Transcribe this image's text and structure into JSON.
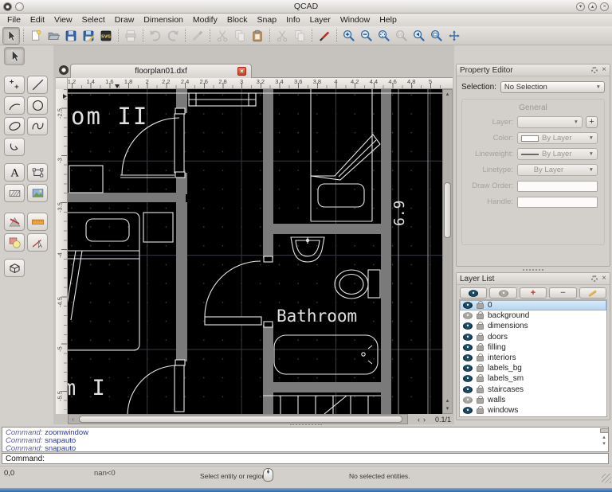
{
  "window": {
    "title": "QCAD"
  },
  "menubar": {
    "items": [
      "File",
      "Edit",
      "View",
      "Select",
      "Draw",
      "Dimension",
      "Modify",
      "Block",
      "Snap",
      "Info",
      "Layer",
      "Window",
      "Help"
    ]
  },
  "toolbar": {
    "groups": [
      [
        {
          "name": "toolbar-selection",
          "icon": "pointer",
          "enabled": true,
          "pressed": true
        }
      ],
      [
        {
          "name": "new-file",
          "icon": "new",
          "enabled": true
        },
        {
          "name": "open-file",
          "icon": "open",
          "enabled": true
        },
        {
          "name": "save",
          "icon": "save",
          "enabled": true
        },
        {
          "name": "save-as",
          "icon": "saveas",
          "enabled": true
        },
        {
          "name": "export",
          "icon": "export",
          "enabled": true
        }
      ],
      [
        {
          "name": "print",
          "icon": "print",
          "enabled": false
        }
      ],
      [
        {
          "name": "undo",
          "icon": "undo",
          "enabled": false
        },
        {
          "name": "redo",
          "icon": "redo",
          "enabled": false
        }
      ],
      [
        {
          "name": "eraser",
          "icon": "eraser",
          "enabled": false
        }
      ],
      [
        {
          "name": "cut",
          "icon": "cut",
          "enabled": false
        },
        {
          "name": "copy",
          "icon": "copy",
          "enabled": false
        },
        {
          "name": "paste",
          "icon": "paste",
          "enabled": true
        }
      ],
      [
        {
          "name": "cut-with-reference",
          "icon": "cut",
          "enabled": false
        },
        {
          "name": "paste-with-reference",
          "icon": "copy",
          "enabled": false
        }
      ],
      [
        {
          "name": "drawing-preferences",
          "icon": "penred",
          "enabled": true
        }
      ],
      [
        {
          "name": "zoom-in",
          "icon": "magplus",
          "enabled": true
        },
        {
          "name": "zoom-out",
          "icon": "magminus",
          "enabled": true
        },
        {
          "name": "auto-zoom",
          "icon": "magauto",
          "enabled": true
        },
        {
          "name": "zoom-one-to-one",
          "icon": "mag11",
          "enabled": false
        },
        {
          "name": "previous-view",
          "icon": "magprev",
          "enabled": true
        },
        {
          "name": "zoom-window",
          "icon": "magwin",
          "enabled": true
        },
        {
          "name": "pan",
          "icon": "pan",
          "enabled": true
        }
      ]
    ]
  },
  "left_toolbar": {
    "groups": [
      [
        {
          "name": "selection-pointer",
          "icon": "pointer",
          "pressed": true
        }
      ],
      [
        {
          "name": "point-tools",
          "icon": "point"
        },
        {
          "name": "line-tools",
          "icon": "line"
        },
        {
          "name": "arc-tools",
          "icon": "arc"
        },
        {
          "name": "circle-tools",
          "icon": "circle"
        },
        {
          "name": "ellipse-tools",
          "icon": "ellipse"
        },
        {
          "name": "spline-tools",
          "icon": "spline"
        },
        {
          "name": "polyline-tools",
          "icon": "polyline"
        }
      ],
      [
        {
          "name": "text-tool",
          "icon": "text"
        },
        {
          "name": "shape-tools",
          "icon": "shape"
        },
        {
          "name": "hatch-tool",
          "icon": "hatch"
        },
        {
          "name": "image-tool",
          "icon": "image"
        }
      ],
      [
        {
          "name": "dimension-tools",
          "icon": "dimension"
        },
        {
          "name": "leader-tool",
          "icon": "leader"
        },
        {
          "name": "modify-tools",
          "icon": "modify"
        },
        {
          "name": "measure-tools",
          "icon": "measure"
        }
      ],
      [
        {
          "name": "projection-tools",
          "icon": "cube"
        }
      ]
    ]
  },
  "document": {
    "tab_label": "floorplan01.dxf"
  },
  "rulers": {
    "horizontal": [
      "1.2",
      "1.4",
      "1.6",
      "1.8",
      "2",
      "2.2",
      "2.4",
      "2.6",
      "2.8",
      "3",
      "3.2",
      "3.4",
      "3.6",
      "3.8",
      "4",
      "4.2",
      "4.4",
      "4.6",
      "4.8",
      "5"
    ],
    "vertical": [
      "-2.5",
      "-3",
      "-3.5",
      "-4",
      "-4.5",
      "-5",
      "-5.5"
    ]
  },
  "canvas": {
    "labels": {
      "room_top": "om II",
      "bathroom": "Bathroom",
      "room_bottom": "m I",
      "dimension": "6.9"
    },
    "zoom_indicator": "0.1/1"
  },
  "property_editor": {
    "title": "Property Editor",
    "selection_label": "Selection:",
    "selection_value": "No Selection",
    "group_title": "General",
    "fields": [
      {
        "label": "Layer:",
        "value": ""
      },
      {
        "label": "Color:",
        "value": "By Layer"
      },
      {
        "label": "Lineweight:",
        "value": "By Layer"
      },
      {
        "label": "Linetype:",
        "value": "By Layer"
      },
      {
        "label": "Draw Order:",
        "value": ""
      },
      {
        "label": "Handle:",
        "value": ""
      }
    ]
  },
  "layer_list": {
    "title": "Layer List",
    "toolbar": [
      {
        "name": "show-all-layers",
        "icon": "eye"
      },
      {
        "name": "hide-all-layers",
        "icon": "eye-off"
      },
      {
        "name": "add-layer",
        "icon": "plus"
      },
      {
        "name": "remove-layer",
        "icon": "minus"
      },
      {
        "name": "edit-layer",
        "icon": "pencil"
      }
    ],
    "layers": [
      {
        "name": "0",
        "visible": true,
        "locked": true,
        "selected": true
      },
      {
        "name": "background",
        "visible": false,
        "locked": true,
        "selected": false
      },
      {
        "name": "dimensions",
        "visible": true,
        "locked": true,
        "selected": false
      },
      {
        "name": "doors",
        "visible": true,
        "locked": true,
        "selected": false
      },
      {
        "name": "filling",
        "visible": true,
        "locked": true,
        "selected": false
      },
      {
        "name": "interiors",
        "visible": true,
        "locked": true,
        "selected": false
      },
      {
        "name": "labels_bg",
        "visible": true,
        "locked": true,
        "selected": false
      },
      {
        "name": "labels_sm",
        "visible": true,
        "locked": true,
        "selected": false
      },
      {
        "name": "staircases",
        "visible": true,
        "locked": true,
        "selected": false
      },
      {
        "name": "walls",
        "visible": false,
        "locked": true,
        "selected": false
      },
      {
        "name": "windows",
        "visible": true,
        "locked": true,
        "selected": false
      }
    ]
  },
  "command_line": {
    "history": [
      {
        "prefix": "Command:",
        "command": "zoomwindow"
      },
      {
        "prefix": "Command:",
        "command": "snapauto"
      },
      {
        "prefix": "Command:",
        "command": "snapauto"
      }
    ],
    "prompt": "Command:"
  },
  "status_bar": {
    "coordinates": "0,0",
    "polar_coordinates": "nan<0",
    "hint": "Select entity or region",
    "selection_info": "No selected entities."
  },
  "colors": {
    "canvas_background": "#000000",
    "wall_gray": "#7a7a7a",
    "drawing_line": "#e8e8e8",
    "selection_highlight": "#b3d2ef",
    "command_text": "#2233bb"
  }
}
